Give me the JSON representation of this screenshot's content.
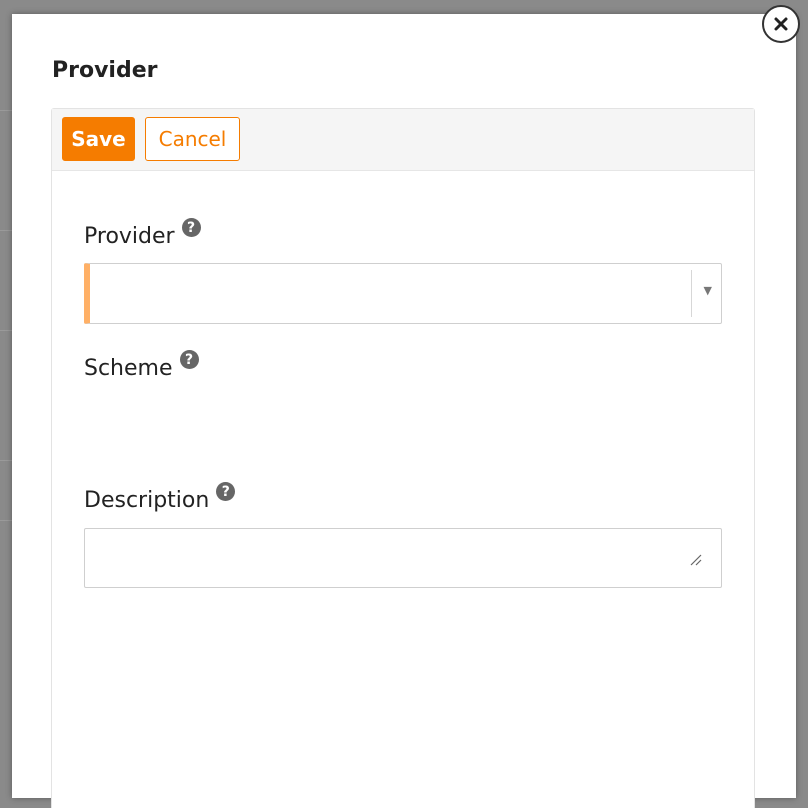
{
  "modal": {
    "title": "Provider",
    "close_icon": "close-icon"
  },
  "toolbar": {
    "save_label": "Save",
    "cancel_label": "Cancel"
  },
  "form": {
    "provider": {
      "label": "Provider",
      "help_icon": "question-circle-icon",
      "value": ""
    },
    "scheme": {
      "label": "Scheme",
      "help_icon": "question-circle-icon"
    },
    "description": {
      "label": "Description",
      "help_icon": "question-circle-icon",
      "value": ""
    }
  },
  "colors": {
    "accent": "#f57c00",
    "required_marker": "#ffb066"
  }
}
